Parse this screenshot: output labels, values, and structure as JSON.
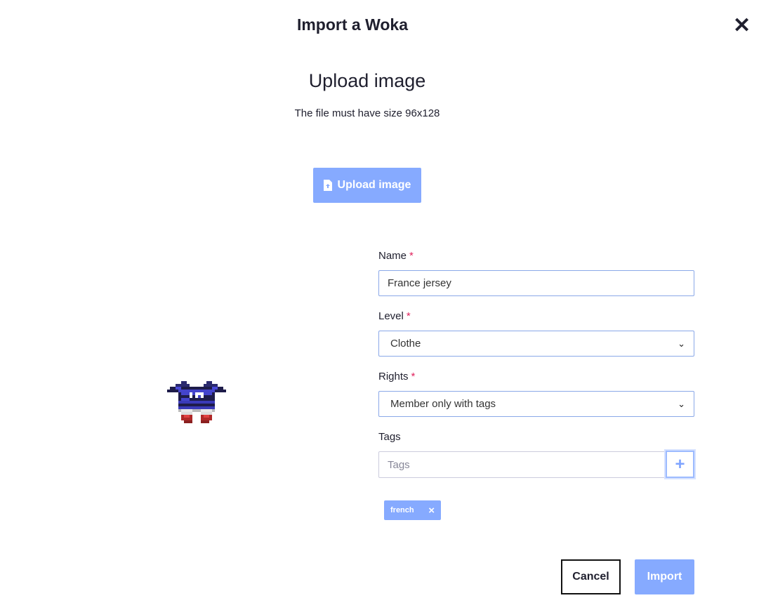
{
  "modal": {
    "title": "Import a Woka",
    "close_icon": "close-icon"
  },
  "upload": {
    "heading": "Upload image",
    "hint": "The file must have size 96x128",
    "button_label": "Upload image",
    "button_icon": "file-upload-icon"
  },
  "form": {
    "name": {
      "label": "Name",
      "required": "*",
      "value": "France jersey"
    },
    "level": {
      "label": "Level",
      "required": "*",
      "selected": "Clothe"
    },
    "rights": {
      "label": "Rights",
      "required": "*",
      "selected": "Member only with tags"
    },
    "tags": {
      "label": "Tags",
      "placeholder": "Tags",
      "add_icon": "plus-icon",
      "chips": [
        {
          "label": "french",
          "remove": "×"
        }
      ]
    }
  },
  "actions": {
    "cancel": "Cancel",
    "import": "Import"
  },
  "colors": {
    "accent": "#86aaff",
    "required": "#e0245e"
  }
}
